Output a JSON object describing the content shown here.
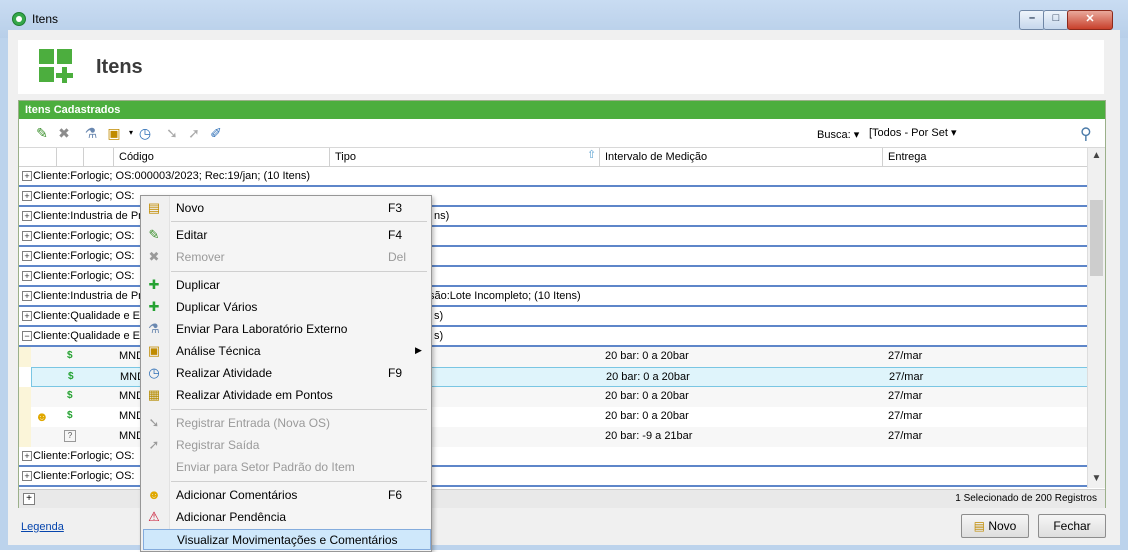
{
  "window": {
    "title": "Itens",
    "min": "–",
    "max": "□",
    "close": "✕"
  },
  "header": {
    "title": "Itens",
    "icon": "grid-plus-icon"
  },
  "grid": {
    "title": "Itens Cadastrados",
    "busca_label": "Busca:",
    "busca_dropdown_arrow": "▾",
    "busca_value": "[Todos - Por Set",
    "columns": {
      "codigo": "Código",
      "tipo": "Tipo",
      "intervalo": "Intervalo de Medição",
      "entrega": "Entrega"
    },
    "groups": [
      {
        "text": "Cliente:Forlogic;    OS:000003/2023;    Rec:19/jan;    (10 Itens)",
        "extra": ""
      },
      {
        "text": "Cliente:Forlogic;    OS:",
        "extra": ""
      },
      {
        "text": "Cliente:Industria de Pro",
        "extra": "ns)"
      },
      {
        "text": "Cliente:Forlogic;    OS:",
        "extra": ""
      },
      {
        "text": "Cliente:Forlogic;    OS:",
        "extra": ""
      },
      {
        "text": "Cliente:Forlogic;    OS:",
        "extra": ""
      },
      {
        "text": "Cliente:Industria de Pro",
        "extra": "são:Lote Incompleto;    (10 Itens)"
      },
      {
        "text": "Cliente:Qualidade e Ex",
        "extra": "s)"
      },
      {
        "text": "Cliente:Qualidade e Ex",
        "extra": "s)"
      }
    ],
    "items": [
      {
        "code": "MND",
        "interval": "20 bar: 0 a 20bar",
        "entrega": "27/mar"
      },
      {
        "code": "MND",
        "interval": "20 bar: 0 a 20bar",
        "entrega": "27/mar"
      },
      {
        "code": "MND",
        "interval": "20 bar: 0 a 20bar",
        "entrega": "27/mar"
      },
      {
        "code": "MND",
        "interval": "20 bar: 0 a 20bar",
        "entrega": "27/mar"
      },
      {
        "code": "MND",
        "interval": "20 bar: -9 a 21bar",
        "entrega": "27/mar"
      }
    ],
    "groups_after": [
      {
        "text": "Cliente:Forlogic;    OS:"
      },
      {
        "text": "Cliente:Forlogic;    OS:"
      }
    ],
    "status": "1 Selecionado de 200 Registros"
  },
  "footer": {
    "legenda": "Legenda",
    "novo": "Novo",
    "fechar": "Fechar"
  },
  "context_menu": {
    "items": [
      {
        "label": "Novo",
        "shortcut": "F3",
        "icon": "new-doc-icon"
      },
      {
        "label": "Editar",
        "shortcut": "F4",
        "icon": "edit-icon"
      },
      {
        "label": "Remover",
        "shortcut": "Del",
        "icon": "delete-icon"
      },
      {
        "label": "Duplicar",
        "shortcut": "",
        "icon": "duplicate-icon"
      },
      {
        "label": "Duplicar Vários",
        "shortcut": "",
        "icon": "duplicate-many-icon"
      },
      {
        "label": "Enviar Para Laboratório Externo",
        "shortcut": "",
        "icon": "lab-icon"
      },
      {
        "label": "Análise Técnica",
        "shortcut": "",
        "icon": "clipboard-icon"
      },
      {
        "label": "Realizar Atividade",
        "shortcut": "F9",
        "icon": "clock-icon"
      },
      {
        "label": "Realizar Atividade em Pontos",
        "shortcut": "",
        "icon": "points-icon"
      },
      {
        "label": "Registrar Entrada (Nova OS)",
        "shortcut": "",
        "icon": "checkin-icon"
      },
      {
        "label": "Registrar Saída",
        "shortcut": "",
        "icon": "checkout-icon"
      },
      {
        "label": "Enviar para Setor Padrão do Item",
        "shortcut": "",
        "icon": "send-icon"
      },
      {
        "label": "Adicionar Comentários",
        "shortcut": "F6",
        "icon": "comment-icon"
      },
      {
        "label": "Adicionar Pendência",
        "shortcut": "",
        "icon": "warning-icon"
      },
      {
        "label": "Visualizar Movimentações e Comentários",
        "shortcut": "",
        "icon": "view-icon"
      }
    ]
  }
}
